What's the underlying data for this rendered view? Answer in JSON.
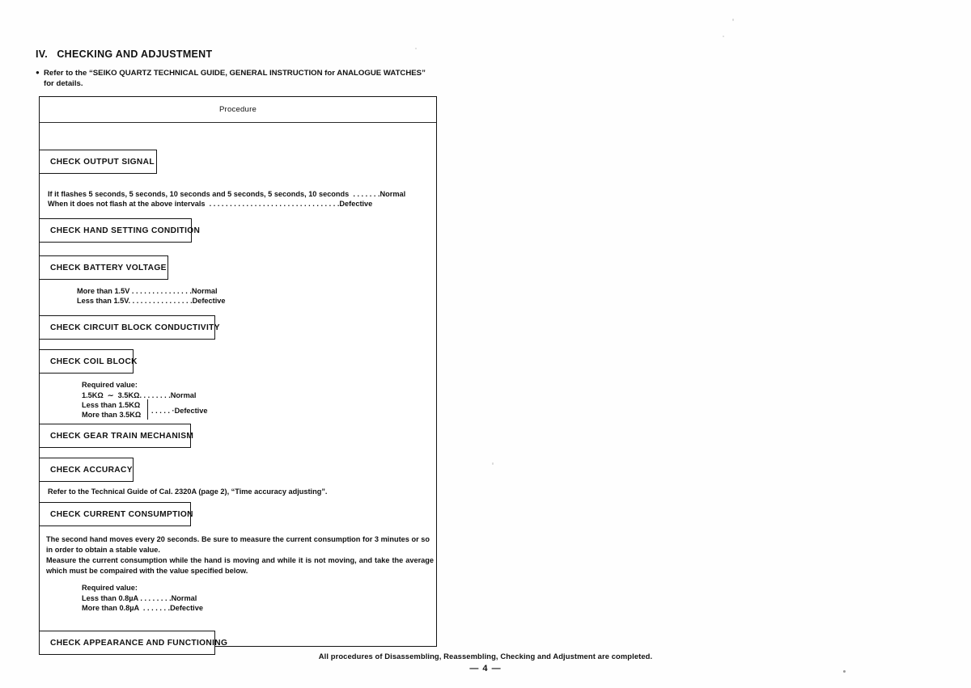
{
  "document": {
    "section_heading": "IV.   CHECKING AND ADJUSTMENT",
    "note_bullet": "●",
    "note_line1": "Refer to the “SEIKO QUARTZ TECHNICAL GUIDE, GENERAL INSTRUCTION for ANALOGUE WATCHES”",
    "note_line2": "for details.",
    "footer_note": "All procedures of Disassembling, Reassembling, Checking and Adjustment are completed.",
    "page_number": "— 4 —"
  },
  "table": {
    "column_header": "Procedure",
    "steps": [
      {
        "label": "CHECK OUTPUT SIGNAL"
      },
      {
        "label": "CHECK HAND SETTING CONDITION"
      },
      {
        "label": "CHECK BATTERY VOLTAGE"
      },
      {
        "label": "CHECK CIRCUIT BLOCK CONDUCTIVITY"
      },
      {
        "label": "CHECK COIL BLOCK"
      },
      {
        "label": "CHECK GEAR TRAIN MECHANISM"
      },
      {
        "label": "CHECK ACCURACY"
      },
      {
        "label": "CHECK CURRENT CONSUMPTION"
      },
      {
        "label": "CHECK APPEARANCE AND FUNCTIONING"
      }
    ],
    "output_signal": {
      "line1": "If it flashes 5 seconds, 5 seconds, 10 seconds and 5 seconds, 5 seconds, 10 seconds  . . . . . . .Normal",
      "line2": "When it does not flash at the above intervals  . . . . . . . . . . . . . . . . . . . . . . . . . . . . . . . .Defective"
    },
    "battery_voltage": {
      "line1": "More than 1.5V . . . . . . . . . . . . . . .Normal",
      "line2": "Less than 1.5V. . . . . . . . . . . . . . . .Defective"
    },
    "coil_block": {
      "title": "Required value:",
      "line1": "1.5KΩ  ∼  3.5KΩ. . . . . . . .Normal",
      "line2": "Less than 1.5KΩ",
      "line3": "More than 3.5KΩ",
      "brace_result": ". . . . . ·Defective"
    },
    "accuracy": {
      "line1": "Refer to the Technical Guide of Cal. 2320A (page 2), “Time accuracy adjusting”."
    },
    "current_consumption": {
      "para1": "The second hand moves every 20 seconds.  Be sure to measure the current consumption for 3 minutes or so in order to obtain a stable value.",
      "para2": "Measure the current consumption while the hand is moving and while it is not moving, and take the average which must be compaired with the value specified below.",
      "title": "Required value:",
      "line1": "Less than 0.8µA . . . . . . . .Normal",
      "line2": "More than 0.8µA  . . . . . . .Defective"
    }
  }
}
